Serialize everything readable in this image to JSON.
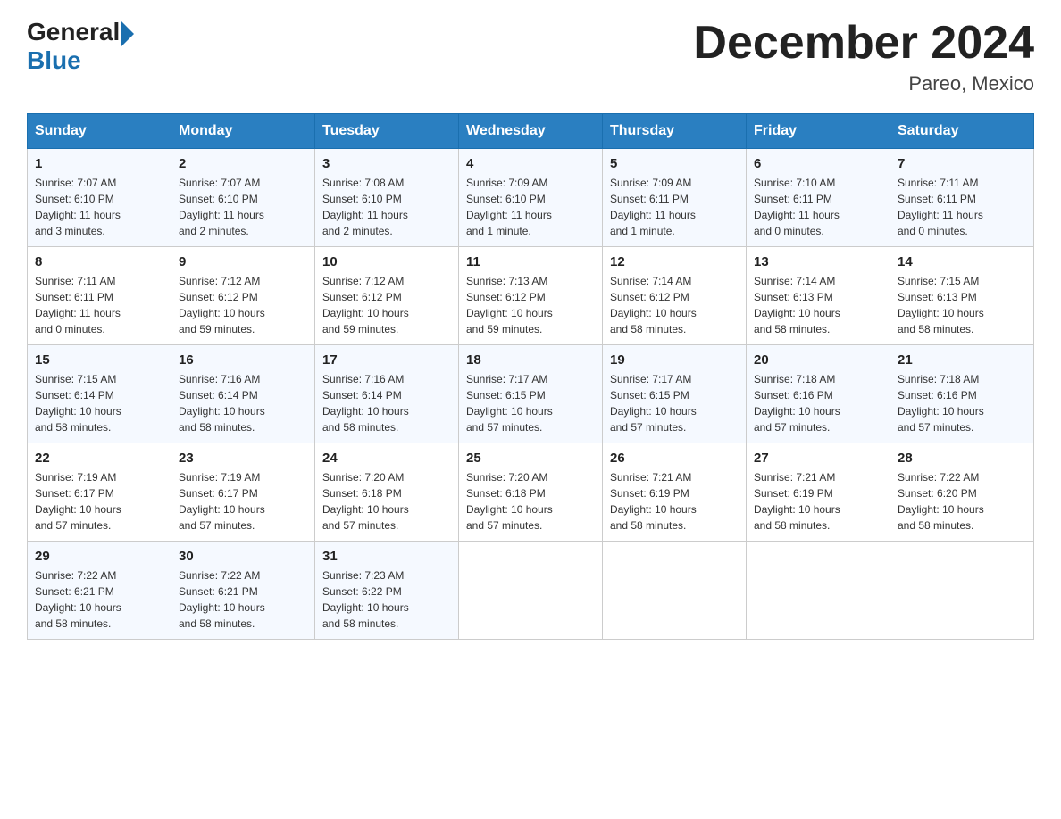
{
  "header": {
    "logo_general": "General",
    "logo_blue": "Blue",
    "month_title": "December 2024",
    "location": "Pareo, Mexico"
  },
  "days_of_week": [
    "Sunday",
    "Monday",
    "Tuesday",
    "Wednesday",
    "Thursday",
    "Friday",
    "Saturday"
  ],
  "weeks": [
    [
      {
        "num": "1",
        "info": "Sunrise: 7:07 AM\nSunset: 6:10 PM\nDaylight: 11 hours\nand 3 minutes."
      },
      {
        "num": "2",
        "info": "Sunrise: 7:07 AM\nSunset: 6:10 PM\nDaylight: 11 hours\nand 2 minutes."
      },
      {
        "num": "3",
        "info": "Sunrise: 7:08 AM\nSunset: 6:10 PM\nDaylight: 11 hours\nand 2 minutes."
      },
      {
        "num": "4",
        "info": "Sunrise: 7:09 AM\nSunset: 6:10 PM\nDaylight: 11 hours\nand 1 minute."
      },
      {
        "num": "5",
        "info": "Sunrise: 7:09 AM\nSunset: 6:11 PM\nDaylight: 11 hours\nand 1 minute."
      },
      {
        "num": "6",
        "info": "Sunrise: 7:10 AM\nSunset: 6:11 PM\nDaylight: 11 hours\nand 0 minutes."
      },
      {
        "num": "7",
        "info": "Sunrise: 7:11 AM\nSunset: 6:11 PM\nDaylight: 11 hours\nand 0 minutes."
      }
    ],
    [
      {
        "num": "8",
        "info": "Sunrise: 7:11 AM\nSunset: 6:11 PM\nDaylight: 11 hours\nand 0 minutes."
      },
      {
        "num": "9",
        "info": "Sunrise: 7:12 AM\nSunset: 6:12 PM\nDaylight: 10 hours\nand 59 minutes."
      },
      {
        "num": "10",
        "info": "Sunrise: 7:12 AM\nSunset: 6:12 PM\nDaylight: 10 hours\nand 59 minutes."
      },
      {
        "num": "11",
        "info": "Sunrise: 7:13 AM\nSunset: 6:12 PM\nDaylight: 10 hours\nand 59 minutes."
      },
      {
        "num": "12",
        "info": "Sunrise: 7:14 AM\nSunset: 6:12 PM\nDaylight: 10 hours\nand 58 minutes."
      },
      {
        "num": "13",
        "info": "Sunrise: 7:14 AM\nSunset: 6:13 PM\nDaylight: 10 hours\nand 58 minutes."
      },
      {
        "num": "14",
        "info": "Sunrise: 7:15 AM\nSunset: 6:13 PM\nDaylight: 10 hours\nand 58 minutes."
      }
    ],
    [
      {
        "num": "15",
        "info": "Sunrise: 7:15 AM\nSunset: 6:14 PM\nDaylight: 10 hours\nand 58 minutes."
      },
      {
        "num": "16",
        "info": "Sunrise: 7:16 AM\nSunset: 6:14 PM\nDaylight: 10 hours\nand 58 minutes."
      },
      {
        "num": "17",
        "info": "Sunrise: 7:16 AM\nSunset: 6:14 PM\nDaylight: 10 hours\nand 58 minutes."
      },
      {
        "num": "18",
        "info": "Sunrise: 7:17 AM\nSunset: 6:15 PM\nDaylight: 10 hours\nand 57 minutes."
      },
      {
        "num": "19",
        "info": "Sunrise: 7:17 AM\nSunset: 6:15 PM\nDaylight: 10 hours\nand 57 minutes."
      },
      {
        "num": "20",
        "info": "Sunrise: 7:18 AM\nSunset: 6:16 PM\nDaylight: 10 hours\nand 57 minutes."
      },
      {
        "num": "21",
        "info": "Sunrise: 7:18 AM\nSunset: 6:16 PM\nDaylight: 10 hours\nand 57 minutes."
      }
    ],
    [
      {
        "num": "22",
        "info": "Sunrise: 7:19 AM\nSunset: 6:17 PM\nDaylight: 10 hours\nand 57 minutes."
      },
      {
        "num": "23",
        "info": "Sunrise: 7:19 AM\nSunset: 6:17 PM\nDaylight: 10 hours\nand 57 minutes."
      },
      {
        "num": "24",
        "info": "Sunrise: 7:20 AM\nSunset: 6:18 PM\nDaylight: 10 hours\nand 57 minutes."
      },
      {
        "num": "25",
        "info": "Sunrise: 7:20 AM\nSunset: 6:18 PM\nDaylight: 10 hours\nand 57 minutes."
      },
      {
        "num": "26",
        "info": "Sunrise: 7:21 AM\nSunset: 6:19 PM\nDaylight: 10 hours\nand 58 minutes."
      },
      {
        "num": "27",
        "info": "Sunrise: 7:21 AM\nSunset: 6:19 PM\nDaylight: 10 hours\nand 58 minutes."
      },
      {
        "num": "28",
        "info": "Sunrise: 7:22 AM\nSunset: 6:20 PM\nDaylight: 10 hours\nand 58 minutes."
      }
    ],
    [
      {
        "num": "29",
        "info": "Sunrise: 7:22 AM\nSunset: 6:21 PM\nDaylight: 10 hours\nand 58 minutes."
      },
      {
        "num": "30",
        "info": "Sunrise: 7:22 AM\nSunset: 6:21 PM\nDaylight: 10 hours\nand 58 minutes."
      },
      {
        "num": "31",
        "info": "Sunrise: 7:23 AM\nSunset: 6:22 PM\nDaylight: 10 hours\nand 58 minutes."
      },
      {
        "num": "",
        "info": ""
      },
      {
        "num": "",
        "info": ""
      },
      {
        "num": "",
        "info": ""
      },
      {
        "num": "",
        "info": ""
      }
    ]
  ]
}
